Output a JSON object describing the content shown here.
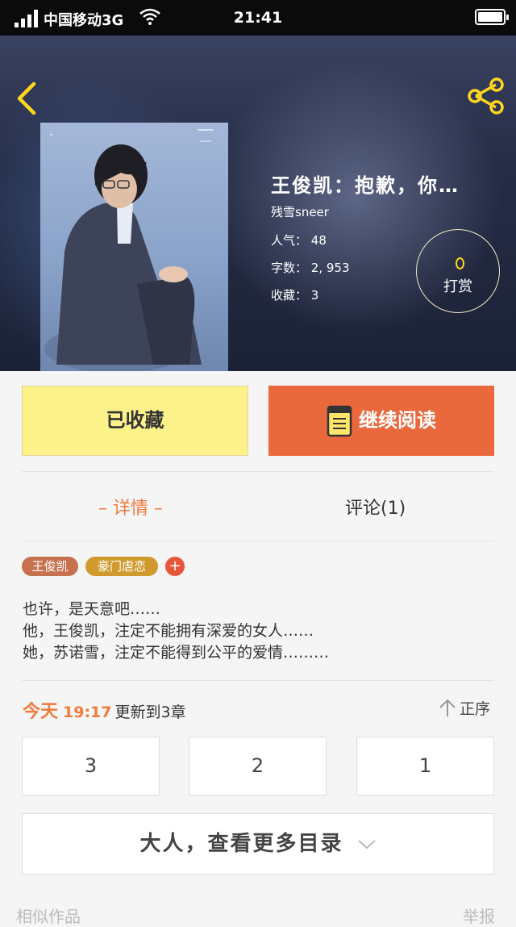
{
  "status_bar": {
    "carrier": "中国移动3G",
    "time": "21:41"
  },
  "book": {
    "title": "王俊凯：抱歉，你…",
    "author": "残雪sneer",
    "popularity_label": "人气：",
    "popularity": "48",
    "word_count_label": "字数：",
    "word_count": "2, 953",
    "favorites_label": "收藏：",
    "favorites": "3",
    "tip_label": "打赏"
  },
  "actions": {
    "collected_label": "已收藏",
    "continue_label": "继续阅读"
  },
  "tabs": {
    "detail": "– 详情 –",
    "comments": "评论(1)"
  },
  "tags": [
    {
      "label": "王俊凯",
      "color": "#c8714f"
    },
    {
      "label": "豪门虐恋",
      "color": "#d19a2e"
    }
  ],
  "tag_add": "+",
  "description": "也许，是天意吧……\n他，王俊凯，注定不能拥有深爱的女人……\n她，苏诺雪，注定不能得到公平的爱情………",
  "update": {
    "today": "今天",
    "time": "19:17",
    "text": "更新到3章"
  },
  "sort_label": "正序",
  "chapters": [
    "3",
    "2",
    "1"
  ],
  "more_label": "大人，查看更多目录",
  "footer": {
    "left": "相似作品",
    "right": "举报"
  },
  "colors": {
    "accent": "#ef7b3e",
    "collected_bg": "#fdf18a",
    "read_bg": "#e9683c"
  }
}
